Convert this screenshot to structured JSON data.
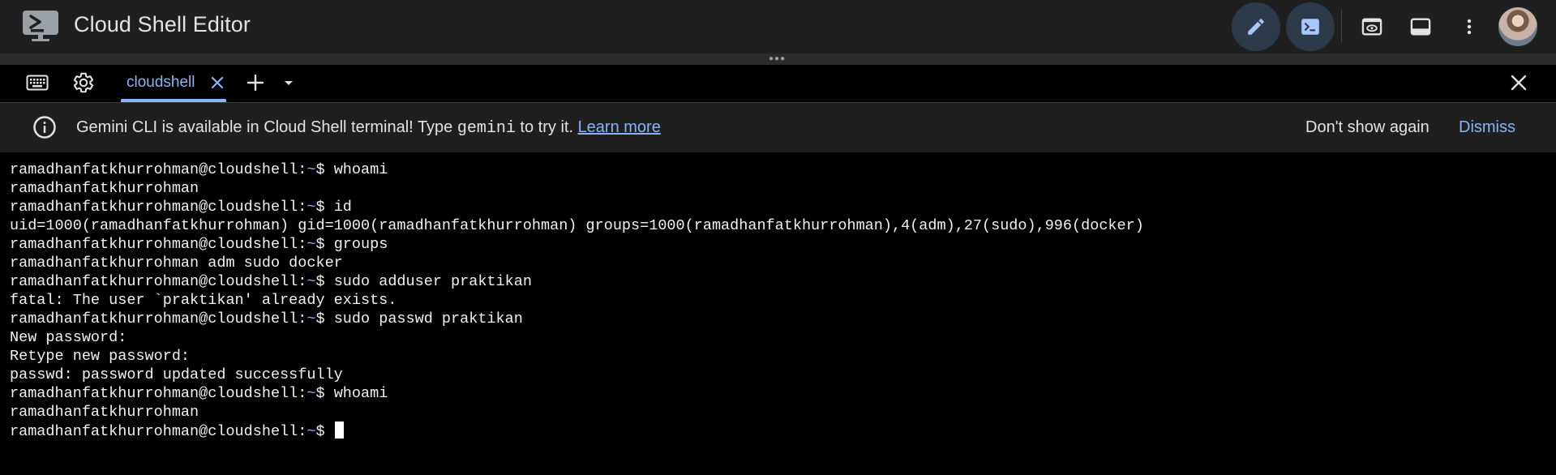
{
  "app": {
    "title": "Cloud Shell Editor"
  },
  "tabs": {
    "active_label": "cloudshell"
  },
  "banner": {
    "text_before": "Gemini CLI is available in Cloud Shell terminal! Type ",
    "command": "gemini",
    "text_after": " to try it. ",
    "link": "Learn more",
    "dont_show": "Don't show again",
    "dismiss": "Dismiss"
  },
  "terminal": {
    "prompt_user": "ramadhanfatkhurrohman@cloudshell:",
    "prompt_path": "~",
    "prompt_symbol": "$ ",
    "lines": [
      {
        "type": "prompt",
        "cmd": "whoami"
      },
      {
        "type": "output",
        "text": "ramadhanfatkhurrohman"
      },
      {
        "type": "prompt",
        "cmd": "id"
      },
      {
        "type": "output",
        "text": "uid=1000(ramadhanfatkhurrohman) gid=1000(ramadhanfatkhurrohman) groups=1000(ramadhanfatkhurrohman),4(adm),27(sudo),996(docker)"
      },
      {
        "type": "prompt",
        "cmd": "groups"
      },
      {
        "type": "output",
        "text": "ramadhanfatkhurrohman adm sudo docker"
      },
      {
        "type": "prompt",
        "cmd": "sudo adduser praktikan"
      },
      {
        "type": "output",
        "text": "fatal: The user `praktikan' already exists."
      },
      {
        "type": "prompt",
        "cmd": "sudo passwd praktikan"
      },
      {
        "type": "output",
        "text": "New password:"
      },
      {
        "type": "output",
        "text": "Retype new password:"
      },
      {
        "type": "output",
        "text": "passwd: password updated successfully"
      },
      {
        "type": "prompt",
        "cmd": "whoami"
      },
      {
        "type": "output",
        "text": "ramadhanfatkhurrohman"
      },
      {
        "type": "prompt",
        "cmd": "",
        "cursor": true
      }
    ]
  },
  "colors": {
    "accent": "#8ab4f8",
    "topbar_bg": "#1f1f1f",
    "terminal_bg": "#000000",
    "terminal_fg": "#f1f1f1"
  },
  "icons": {
    "logo": "cloud-shell-terminal-icon",
    "edit": "pencil-icon",
    "terminal": "terminal-prompt-icon",
    "preview": "web-preview-icon",
    "panel": "panel-layout-icon",
    "more": "more-vert-icon",
    "keyboard": "keyboard-icon",
    "settings": "gear-icon",
    "close_tab": "close-icon",
    "add_tab": "plus-icon",
    "tab_dropdown": "chevron-down-icon",
    "close_panel": "close-icon",
    "info": "info-icon"
  }
}
